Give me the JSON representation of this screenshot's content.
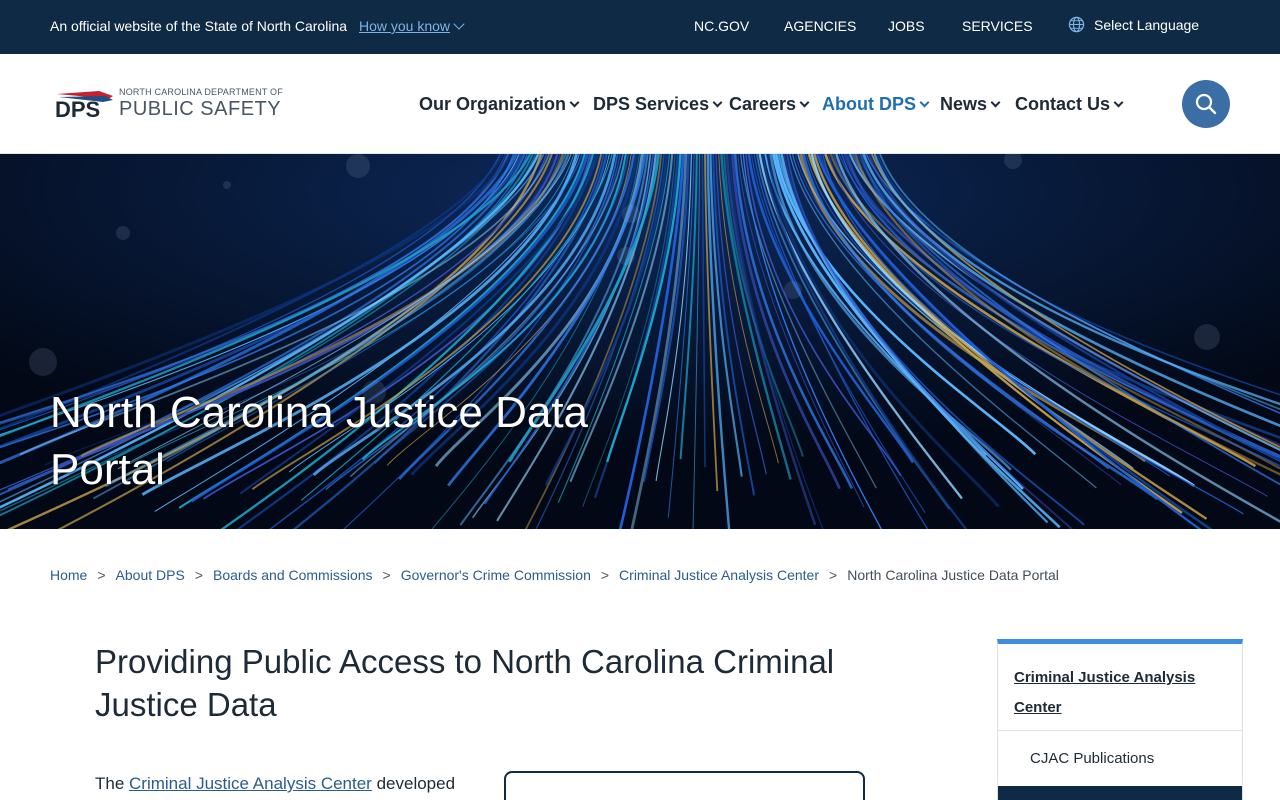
{
  "utility_bar": {
    "official_text": "An official website of the State of North Carolina",
    "how_you_know": "How you know",
    "links": [
      "NC.GOV",
      "AGENCIES",
      "JOBS",
      "SERVICES"
    ],
    "language": "Select Language"
  },
  "header": {
    "logo": {
      "acronym": "DPS",
      "small_text": "NORTH CAROLINA DEPARTMENT OF",
      "big_text": "PUBLIC SAFETY"
    },
    "nav": [
      {
        "label": "Our Organization"
      },
      {
        "label": "DPS Services"
      },
      {
        "label": "Careers"
      },
      {
        "label": "About DPS"
      },
      {
        "label": "News"
      },
      {
        "label": "Contact Us"
      }
    ],
    "active_nav": "About DPS"
  },
  "hero": {
    "title": "North Carolina Justice Data Portal"
  },
  "breadcrumb": {
    "items": [
      "Home",
      "About DPS",
      "Boards and Commissions",
      "Governor's Crime Commission",
      "Criminal Justice Analysis Center"
    ],
    "current": "North Carolina Justice Data Portal",
    "separator": ">"
  },
  "main": {
    "heading": "Providing Public Access to North Carolina Criminal Justice Data",
    "intro_prefix": "The",
    "intro_link": "Criminal Justice Analysis Center",
    "intro_suffix": "developed"
  },
  "sidebar": {
    "heading": "Criminal Justice Analysis Center",
    "items": [
      "CJAC Publications"
    ]
  },
  "colors": {
    "util_bar_bg": "#0f2a44",
    "accent_blue": "#1f6fb0",
    "link_blue": "#2a5d8f",
    "search_bg": "#3a6ea5",
    "sidebar_top_border": "#3e8ee0"
  }
}
